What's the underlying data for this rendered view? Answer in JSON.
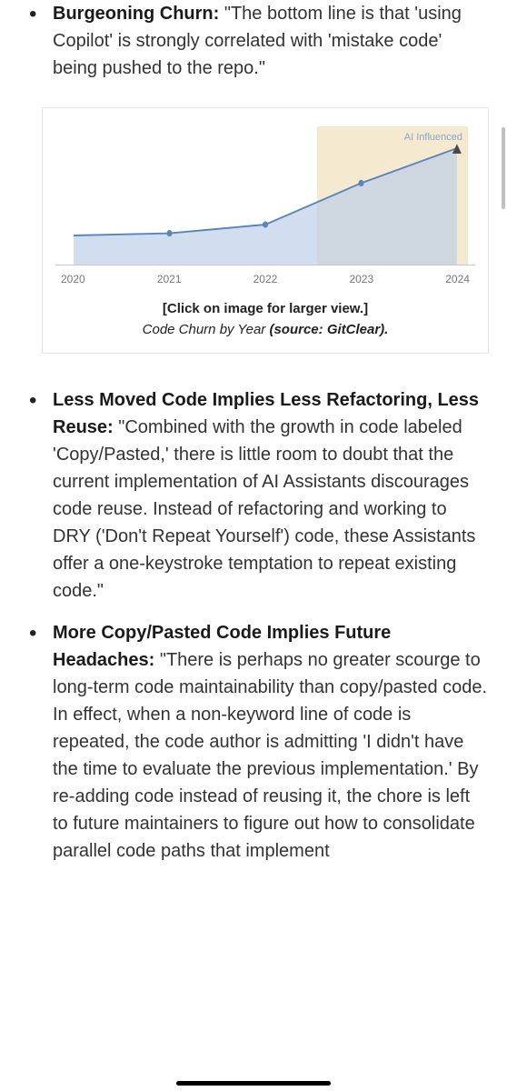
{
  "bullets": [
    {
      "heading": "Burgeoning Churn:",
      "body": " \"The bottom line is that 'using Copilot' is strongly correlated with 'mistake code' being pushed to the repo.\""
    },
    {
      "heading": "Less Moved Code Implies Less Refactoring, Less Reuse:",
      "body": " \"Combined with the growth in code labeled 'Copy/Pasted,' there is little room to doubt that the current implementation of AI Assistants discourages code reuse. Instead of refactoring and working to DRY ('Don't Repeat Yourself') code, these Assistants offer a one-keystroke temptation to repeat existing code.\""
    },
    {
      "heading": "More Copy/Pasted Code Implies Future Headaches:",
      "body": " \"There is perhaps no greater scourge to long-term code maintainability than copy/pasted code. In effect, when a non-keyword line of code is repeated, the code author is admitting 'I didn't have the time to evaluate the previous implementation.' By re-adding code instead of reusing it, the chore is left to future maintainers to figure out how to consolidate parallel code paths that implement"
    }
  ],
  "figure": {
    "ai_label": "AI Influenced",
    "click_text": "[Click on image for larger view.]",
    "caption_text": "Code Churn by Year ",
    "source_label": "(source: ",
    "source_value": "GitClear",
    "source_close": ")."
  },
  "chart_data": {
    "type": "line",
    "title": "Code Churn by Year",
    "x": [
      "2020",
      "2021",
      "2022",
      "2023",
      "2024"
    ],
    "values": [
      40,
      42,
      48,
      72,
      92
    ],
    "ai_influenced_start": "2023",
    "xlabel": "",
    "ylabel": "",
    "ylim": [
      0,
      100
    ]
  }
}
